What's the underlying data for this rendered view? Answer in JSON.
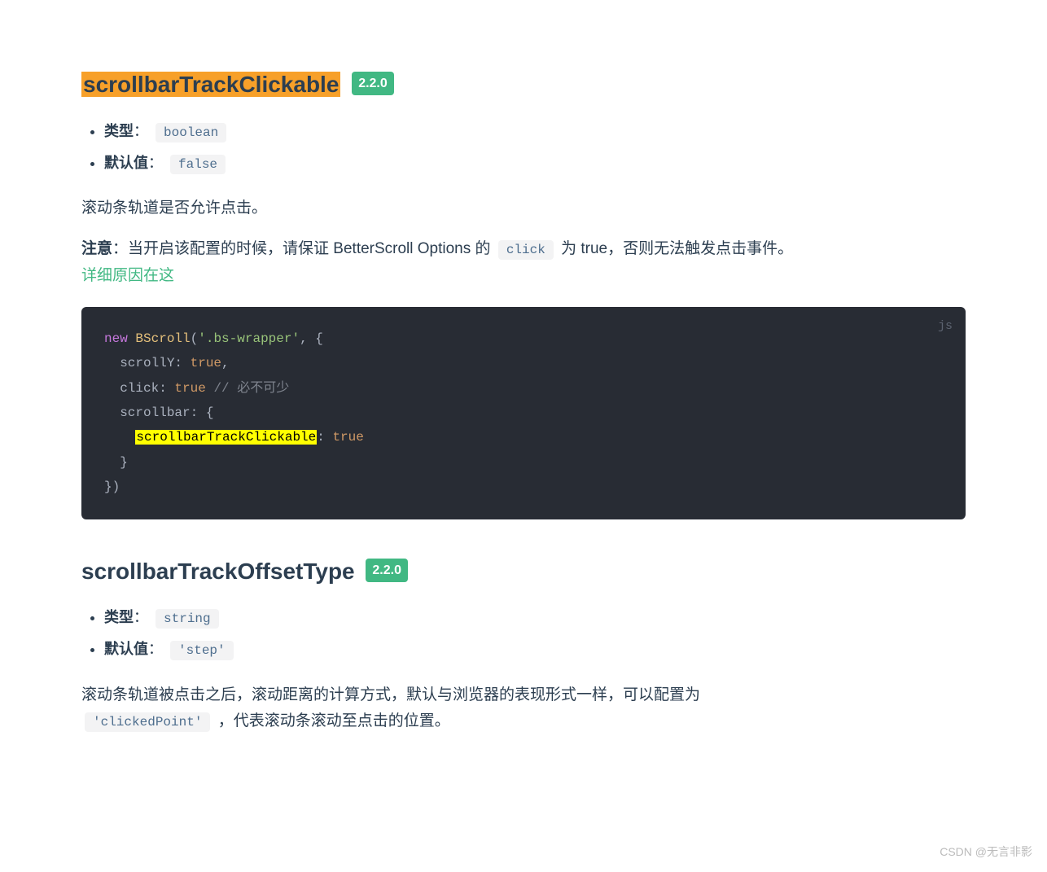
{
  "section1": {
    "title": "scrollbarTrackClickable",
    "version": "2.2.0",
    "typeLabel": "类型",
    "typeValue": "boolean",
    "defaultLabel": "默认值",
    "defaultValue": "false",
    "desc": "滚动条轨道是否允许点击。",
    "noteLabel": "注意",
    "noteBefore": "：当开启该配置的时候，请保证 BetterScroll Options 的 ",
    "noteCode": "click",
    "noteAfter": " 为 true，否则无法触发点击事件。",
    "linkText": "详细原因在这",
    "code": {
      "lang": "js",
      "kw_new": "new",
      "cls": "BScroll",
      "open": "(",
      "str": "'.bs-wrapper'",
      "comma_brace": ", {",
      "p_scrollY": "scrollY",
      "v_true1": "true",
      "p_click": "click",
      "v_true2": "true",
      "comment": "// 必不可少",
      "p_scrollbar": "scrollbar",
      "brace_open": ": {",
      "p_hl": "scrollbarTrackClickable",
      "v_true3": "true",
      "brace_close_inner": "}",
      "brace_close_outer": "})"
    }
  },
  "section2": {
    "title": "scrollbarTrackOffsetType",
    "version": "2.2.0",
    "typeLabel": "类型",
    "typeValue": "string",
    "defaultLabel": "默认值",
    "defaultValue": "'step'",
    "descBefore": "滚动条轨道被点击之后，滚动距离的计算方式，默认与浏览器的表现形式一样，可以配置为 ",
    "descCode": "'clickedPoint'",
    "descAfter": " ，代表滚动条滚动至点击的位置。"
  },
  "watermark": "CSDN @无言非影"
}
